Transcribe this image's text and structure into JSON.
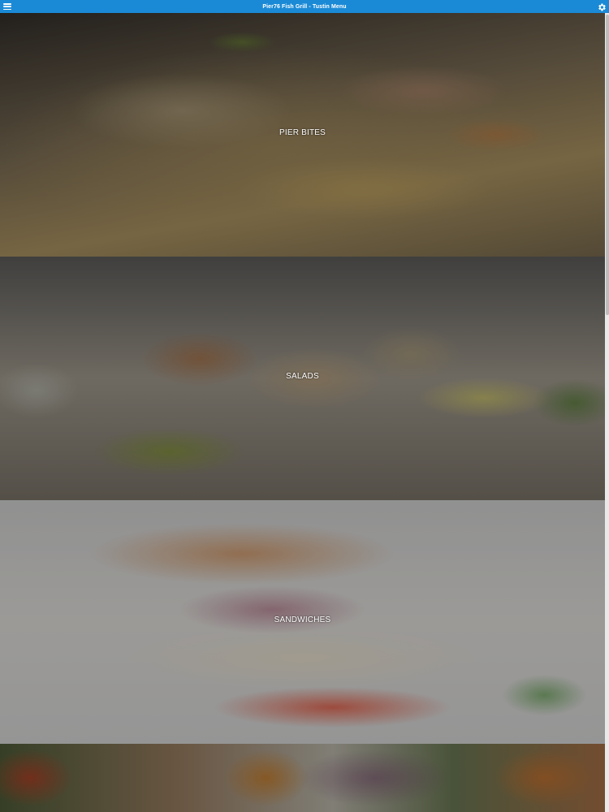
{
  "app": {
    "title": "Pier76 Fish Grill - Tustin Menu"
  },
  "icons": {
    "menu": "hamburger-menu-icon",
    "settings": "gear-icon"
  },
  "colors": {
    "topbar": "#1a8ad6",
    "label_text": "#ffffff"
  },
  "categories": [
    {
      "label": "PIER BITES"
    },
    {
      "label": "SALADS"
    },
    {
      "label": "SANDWICHES"
    },
    {
      "label": ""
    }
  ]
}
